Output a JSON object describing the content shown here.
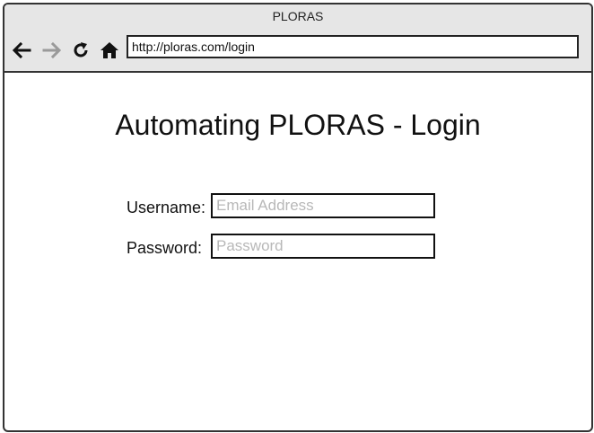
{
  "window": {
    "title": "PLORAS"
  },
  "toolbar": {
    "back_icon": "back-arrow-icon",
    "forward_icon": "forward-arrow-icon",
    "reload_icon": "reload-icon",
    "home_icon": "home-icon",
    "url": "http://ploras.com/login"
  },
  "page": {
    "title": "Automating PLORAS - Login",
    "username": {
      "label": "Username:",
      "placeholder": "Email Address",
      "value": ""
    },
    "password": {
      "label": "Password:",
      "placeholder": "Password",
      "value": ""
    }
  },
  "colors": {
    "chrome_bg": "#e6e6e6",
    "border": "#333333",
    "placeholder": "#b8b8b8",
    "forward_disabled": "#9a9a9a"
  }
}
